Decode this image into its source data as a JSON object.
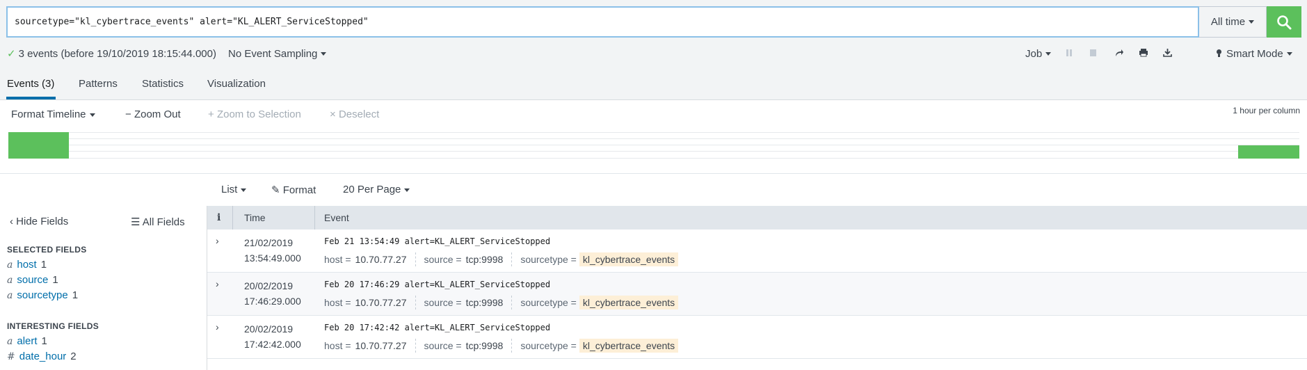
{
  "search": {
    "query": "sourcetype=\"kl_cybertrace_events\" alert=\"KL_ALERT_ServiceStopped\"",
    "time_range": "All time"
  },
  "status": {
    "event_summary": "3 events (before 19/10/2019 18:15:44.000)",
    "sampling": "No Event Sampling",
    "job_label": "Job",
    "mode": "Smart Mode"
  },
  "tabs": [
    {
      "label": "Events (3)"
    },
    {
      "label": "Patterns"
    },
    {
      "label": "Statistics"
    },
    {
      "label": "Visualization"
    }
  ],
  "timeline": {
    "format_label": "Format Timeline",
    "zoom_out": "Zoom Out",
    "zoom_selection": "Zoom to Selection",
    "deselect": "Deselect",
    "scale": "1 hour per column"
  },
  "results_toolbar": {
    "list": "List",
    "format": "Format",
    "per_page": "20 Per Page"
  },
  "fields_panel": {
    "hide_fields": "Hide Fields",
    "all_fields": "All Fields",
    "selected_heading": "SELECTED FIELDS",
    "interesting_heading": "INTERESTING FIELDS",
    "selected": [
      {
        "type": "a",
        "name": "host",
        "count": "1"
      },
      {
        "type": "a",
        "name": "source",
        "count": "1"
      },
      {
        "type": "a",
        "name": "sourcetype",
        "count": "1"
      }
    ],
    "interesting": [
      {
        "type": "a",
        "name": "alert",
        "count": "1"
      },
      {
        "type": "#",
        "name": "date_hour",
        "count": "2"
      }
    ]
  },
  "events_table": {
    "col_info": "i",
    "col_time": "Time",
    "col_event": "Event",
    "rows": [
      {
        "date": "21/02/2019",
        "time": "13:54:49.000",
        "raw": "Feb 21 13:54:49 alert=KL_ALERT_ServiceStopped",
        "host_key": "host =",
        "host": "10.70.77.27",
        "source_key": "source =",
        "source": "tcp:9998",
        "sourcetype_key": "sourcetype =",
        "sourcetype": "kl_cybertrace_events"
      },
      {
        "date": "20/02/2019",
        "time": "17:46:29.000",
        "raw": "Feb 20 17:46:29 alert=KL_ALERT_ServiceStopped",
        "host_key": "host =",
        "host": "10.70.77.27",
        "source_key": "source =",
        "source": "tcp:9998",
        "sourcetype_key": "sourcetype =",
        "sourcetype": "kl_cybertrace_events"
      },
      {
        "date": "20/02/2019",
        "time": "17:42:42.000",
        "raw": "Feb 20 17:42:42 alert=KL_ALERT_ServiceStopped",
        "host_key": "host =",
        "host": "10.70.77.27",
        "source_key": "source =",
        "source": "tcp:9998",
        "sourcetype_key": "sourcetype =",
        "sourcetype": "kl_cybertrace_events"
      }
    ]
  },
  "colors": {
    "accent": "#006eaa",
    "success": "#5cc05c",
    "highlight": "#fdefd7"
  }
}
